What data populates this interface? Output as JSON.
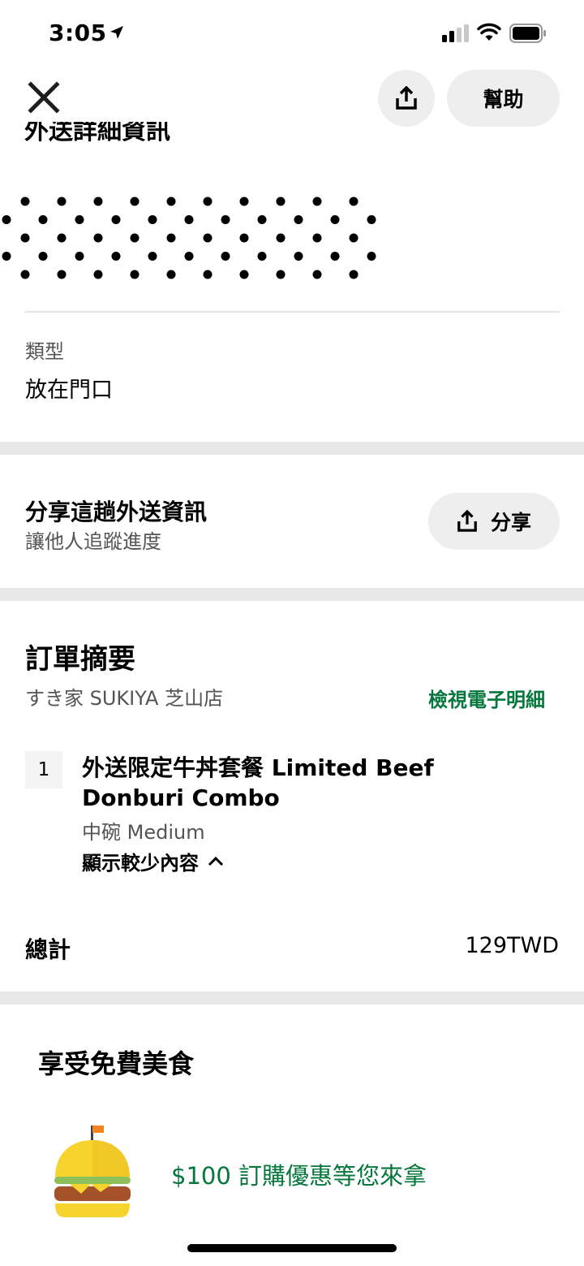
{
  "status_bar": {
    "time": "3:05"
  },
  "header": {
    "help_label": "幫助",
    "title": "外送詳細資訊"
  },
  "delivery_type": {
    "label": "類型",
    "value": "放在門口"
  },
  "share_section": {
    "title": "分享這趟外送資訊",
    "subtitle": "讓他人追蹤進度",
    "button_label": "分享"
  },
  "order_summary": {
    "heading": "訂單摘要",
    "store": "すき家 SUKIYA 芝山店",
    "receipt_link": "檢視電子明細",
    "item": {
      "quantity": "1",
      "name": "外送限定牛丼套餐 Limited Beef Donburi Combo",
      "variant": "中碗 Medium",
      "toggle_label": "顯示較少內容"
    },
    "total_label": "總計",
    "total_value": "129TWD"
  },
  "promo": {
    "heading": "享受免費美食",
    "offer_text": "$100 訂購優惠等您來拿"
  },
  "colors": {
    "accent_green": "#05763c",
    "band_gray": "#e8e8e8",
    "button_gray": "#eeeeee"
  }
}
